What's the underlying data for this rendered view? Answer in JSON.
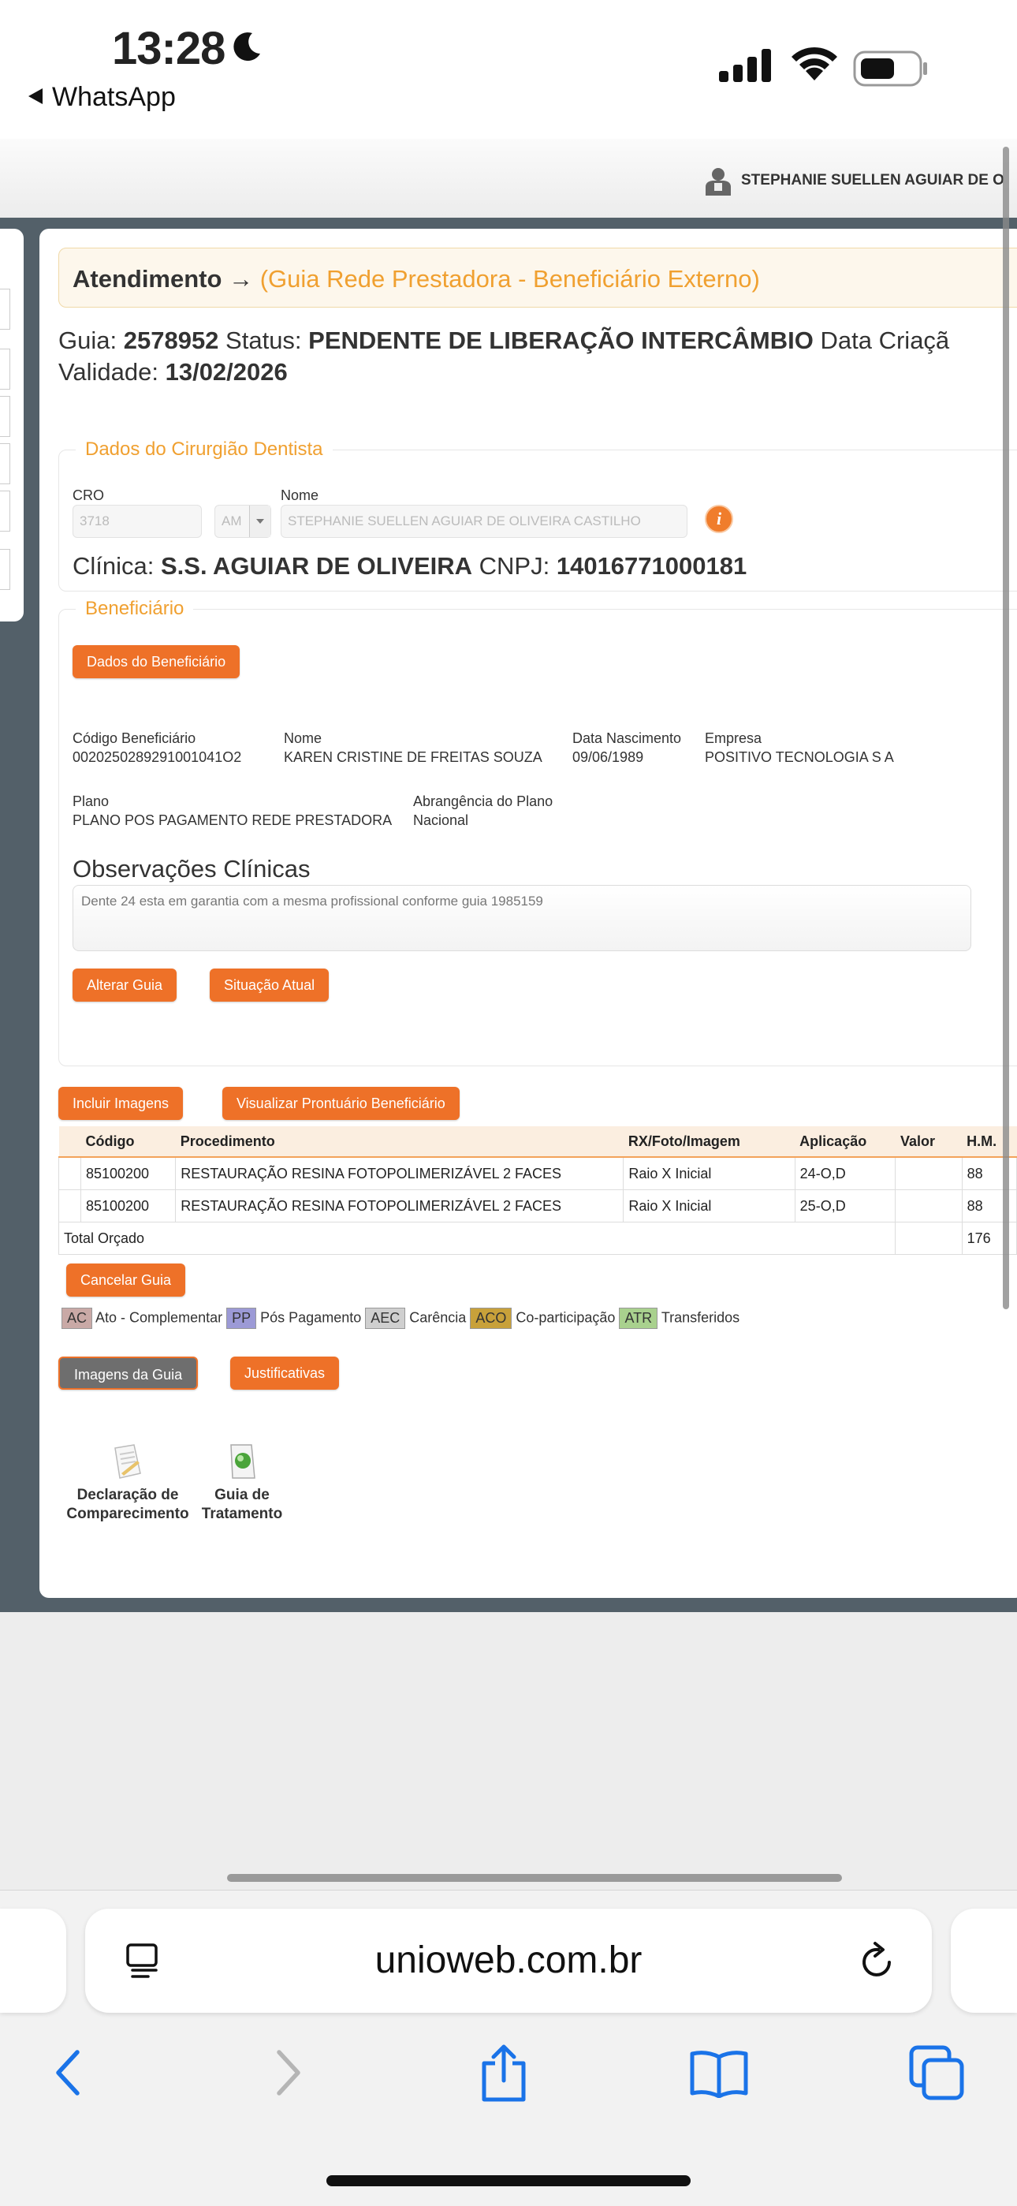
{
  "status_bar": {
    "time": "13:28",
    "back_app": "WhatsApp"
  },
  "header": {
    "user_name": "STEPHANIE SUELLEN AGUIAR DE O"
  },
  "breadcrumb": {
    "title": "Atendimento →",
    "subtitle": "(Guia Rede Prestadora - Beneficiário Externo)"
  },
  "guide": {
    "guia_label": "Guia:",
    "guia_value": "2578952",
    "status_label": "Status:",
    "status_value": "PENDENTE DE LIBERAÇÃO INTERCÂMBIO",
    "data_criacao_label": "Data Criaçã",
    "validade_label": "Validade:",
    "validade_value": "13/02/2026"
  },
  "dentist": {
    "legend": "Dados do Cirurgião Dentista",
    "cro_label": "CRO",
    "cro_value": "3718",
    "uf_value": "AM",
    "nome_label": "Nome",
    "nome_value": "STEPHANIE SUELLEN AGUIAR DE OLIVEIRA CASTILHO",
    "info_icon": "i",
    "clinica_label": "Clínica:",
    "clinica_value": "S.S. AGUIAR DE OLIVEIRA",
    "cnpj_label": "CNPJ:",
    "cnpj_value": "14016771000181"
  },
  "beneficiary": {
    "legend": "Beneficiário",
    "dados_button": "Dados do Beneficiário",
    "codigo_label": "Código Beneficiário",
    "codigo_value": "0020250289291001041O2",
    "nome_label": "Nome",
    "nome_value": "KAREN CRISTINE DE FREITAS SOUZA",
    "nascimento_label": "Data Nascimento",
    "nascimento_value": "09/06/1989",
    "empresa_label": "Empresa",
    "empresa_value": "POSITIVO TECNOLOGIA S A",
    "plano_label": "Plano",
    "plano_value": "PLANO POS PAGAMENTO REDE PRESTADORA",
    "abrangencia_label": "Abrangência do Plano",
    "abrangencia_value": "Nacional"
  },
  "observacoes": {
    "title": "Observações Clínicas",
    "text": "Dente 24 esta em garantia com a mesma profissional conforme guia 1985159"
  },
  "buttons": {
    "alterar_guia": "Alterar Guia",
    "situacao_atual": "Situação Atual",
    "incluir_imagens": "Incluir Imagens",
    "visualizar_prontuario": "Visualizar Prontuário Beneficiário",
    "cancelar_guia": "Cancelar Guia",
    "imagens_guia": "Imagens da Guia",
    "justificativas": "Justificativas"
  },
  "table": {
    "headers": [
      "Código",
      "Procedimento",
      "RX/Foto/Imagem",
      "Aplicação",
      "Valor",
      "H.M."
    ],
    "rows": [
      [
        "85100200",
        "RESTAURAÇÃO RESINA FOTOPOLIMERIZÁVEL 2 FACES",
        "Raio X Inicial",
        "24-O,D",
        "",
        "88"
      ],
      [
        "85100200",
        "RESTAURAÇÃO RESINA FOTOPOLIMERIZÁVEL 2 FACES",
        "Raio X Inicial",
        "25-O,D",
        "",
        "88"
      ]
    ],
    "total_label": "Total Orçado",
    "total_value": "176"
  },
  "legend": [
    {
      "code": "AC",
      "label": "Ato - Complementar",
      "color": "#c9a9a6"
    },
    {
      "code": "PP",
      "label": "Pós Pagamento",
      "color": "#9c9ad6"
    },
    {
      "code": "AEC",
      "label": "Carência",
      "color": "#cfcfcf"
    },
    {
      "code": "ACO",
      "label": "Co-participação",
      "color": "#c8a13a"
    },
    {
      "code": "ATR",
      "label": "Transferidos",
      "color": "#a9d18e"
    }
  ],
  "documents": {
    "declaracao_line1": "Declaração de",
    "declaracao_line2": "Comparecimento",
    "guia_line1": "Guia de",
    "guia_line2": "Tratamento"
  },
  "safari": {
    "url": "unioweb.com.br"
  }
}
